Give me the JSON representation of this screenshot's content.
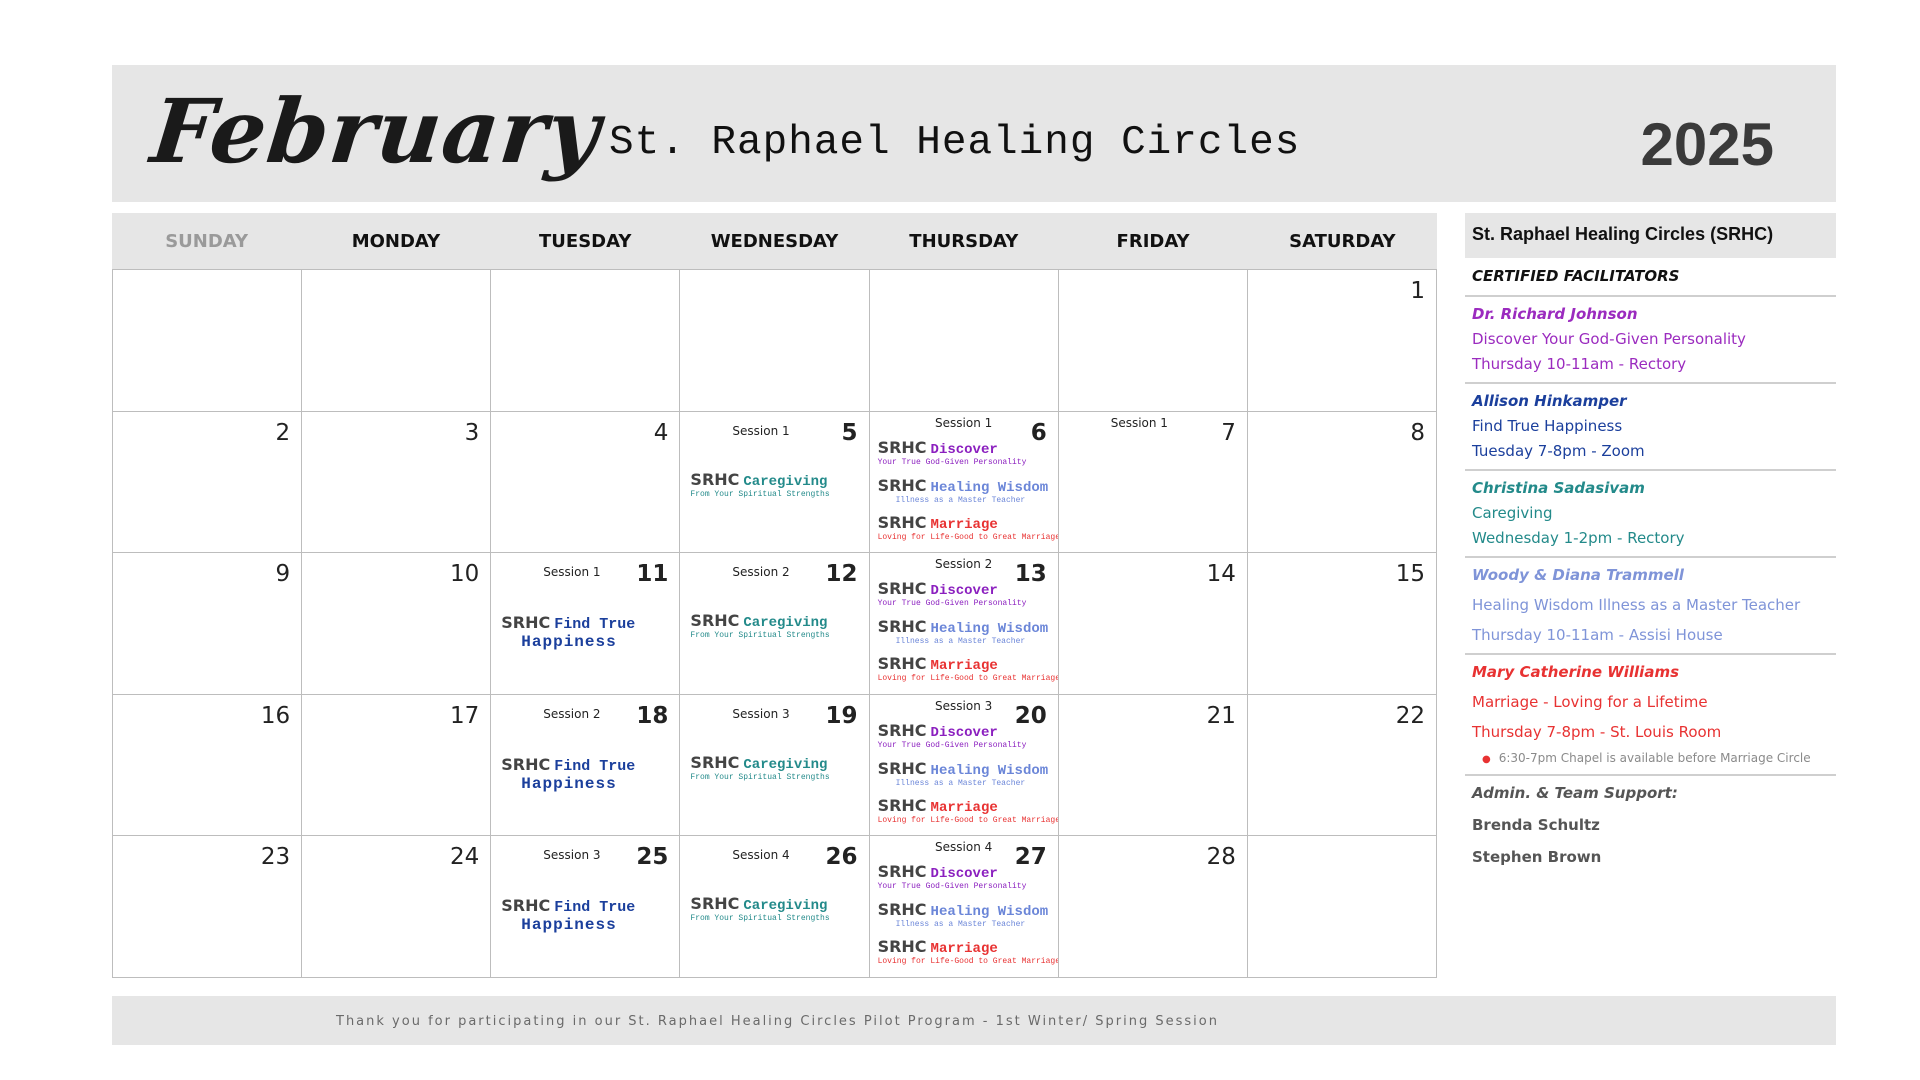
{
  "header": {
    "month": "February",
    "title": "St. Raphael Healing Circles",
    "year": "2025"
  },
  "weekdays": [
    "SUNDAY",
    "MONDAY",
    "TUESDAY",
    "WEDNESDAY",
    "THURSDAY",
    "FRIDAY",
    "SATURDAY"
  ],
  "days": {
    "d1": "1",
    "d2": "2",
    "d3": "3",
    "d4": "4",
    "d5": "5",
    "d6": "6",
    "d7": "7",
    "d8": "8",
    "d9": "9",
    "d10": "10",
    "d11": "11",
    "d12": "12",
    "d13": "13",
    "d14": "14",
    "d15": "15",
    "d16": "16",
    "d17": "17",
    "d18": "18",
    "d19": "19",
    "d20": "20",
    "d21": "21",
    "d22": "22",
    "d23": "23",
    "d24": "24",
    "d25": "25",
    "d26": "26",
    "d27": "27",
    "d28": "28"
  },
  "sessions": {
    "s1": "Session 1",
    "s2": "Session 2",
    "s3": "Session 3",
    "s4": "Session 4"
  },
  "programs": {
    "srhc": "SRHC",
    "discover": "Discover",
    "discover_sub": "Your True God-Given Personality",
    "healing": "Healing Wisdom",
    "healing_sub": "Illness as a Master Teacher",
    "marriage": "Marriage",
    "marriage_sub": "Loving for Life-Good to Great Marriage",
    "caregiving": "Caregiving",
    "caregiving_sub": "From Your Spiritual Strengths",
    "find_true": "Find True",
    "happiness": "Happiness"
  },
  "sidebar": {
    "heading": "St. Raphael Healing Circles (SRHC)",
    "subheading": "CERTIFIED FACILITATORS",
    "facilitators": [
      {
        "name": "Dr. Richard Johnson",
        "program": "Discover Your God-Given Personality",
        "schedule": "Thursday 10-11am - Rectory"
      },
      {
        "name": "Allison Hinkamper",
        "program": "Find True Happiness",
        "schedule": "Tuesday 7-8pm - Zoom"
      },
      {
        "name": "Christina Sadasivam",
        "program": "Caregiving",
        "schedule": "Wednesday 1-2pm - Rectory"
      },
      {
        "name": "Woody & Diana Trammell",
        "program": "Healing Wisdom Illness as a Master Teacher",
        "schedule": "Thursday 10-11am - Assisi House"
      },
      {
        "name": "Mary Catherine Williams",
        "program": "Marriage - Loving for a Lifetime",
        "schedule": "Thursday 7-8pm - St. Louis Room",
        "note": "6:30-7pm Chapel is available before Marriage Circle"
      }
    ],
    "admin_label": "Admin. & Team Support:",
    "admin_members": [
      "Brenda Schultz",
      "Stephen Brown"
    ]
  },
  "footer": {
    "message": "Thank you for participating in our St. Raphael Healing Circles Pilot Program  - 1st Winter/ Spring Session"
  },
  "colors": {
    "band": "#e6e6e6",
    "discover": "#8b1fbf",
    "healing": "#6b86d8",
    "marriage": "#e83232",
    "caregiving": "#238a8a",
    "happiness": "#1b3f9c"
  }
}
